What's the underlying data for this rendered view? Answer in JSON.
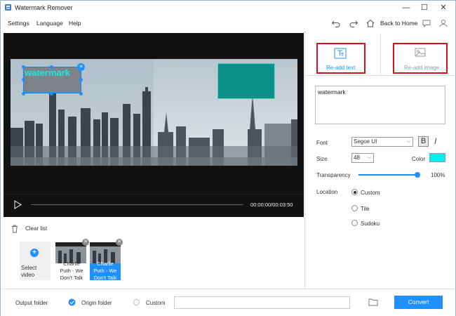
{
  "app": {
    "title": "Watermark Remover"
  },
  "window_controls": {
    "minimize": "—",
    "maximize": "☐",
    "close": "✕"
  },
  "menu": {
    "settings": "Settings",
    "language": "Language",
    "help": "Help"
  },
  "toolbar": {
    "back_to_home": "Back to Home"
  },
  "watermark_overlay": {
    "text": "watermark",
    "close": "✕"
  },
  "player": {
    "time": "00:00:00/00:03:50",
    "play": "▷"
  },
  "file_list": {
    "clear_list": "Clear list",
    "select_video_label": "Select video",
    "thumbs": [
      {
        "caption": "Charlie Puth - We Don't Talk",
        "selected": false
      },
      {
        "caption": "Charlie Puth - We Don't Talk",
        "selected": true
      }
    ]
  },
  "tabs": [
    {
      "label": "Re-add text",
      "active": true
    },
    {
      "label": "Re-add image",
      "active": false
    }
  ],
  "text_panel": {
    "input_value": "watermark",
    "font_label": "Font",
    "font_value": "Segoe UI",
    "bold": "B",
    "italic": "I",
    "size_label": "Size",
    "size_value": "48",
    "color_label": "Color",
    "color_value": "#00f0f0",
    "transparency_label": "Transparency",
    "transparency_value": "100%",
    "transparency_level": 1.0,
    "location_label": "Location",
    "location_options": [
      {
        "label": "Custom",
        "selected": true
      },
      {
        "label": "Tile",
        "selected": false
      },
      {
        "label": "Sudoku",
        "selected": false
      }
    ]
  },
  "output": {
    "label": "Output folder",
    "origin_label": "Origin folder",
    "custom_label": "Custom",
    "convert_label": "Convert"
  },
  "colors": {
    "accent": "#1e90ff",
    "highlight_red": "#d0121b",
    "teal_box": "#0d8f8a"
  }
}
